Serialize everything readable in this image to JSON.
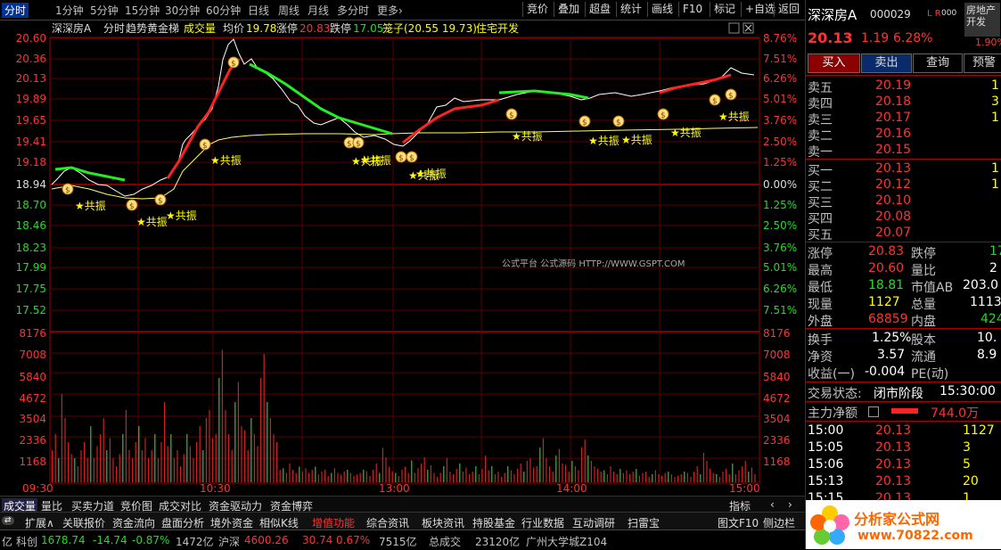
{
  "top_tabs": [
    "分时",
    "1分钟",
    "5分钟",
    "15分钟",
    "30分钟",
    "60分钟",
    "日线",
    "周线",
    "月线",
    "多分时",
    "更多›"
  ],
  "top_buttons": [
    "竞价",
    "叠加",
    "超盘",
    "统计",
    "画线",
    "F10",
    "标记",
    "+自选",
    "返回"
  ],
  "chart": {
    "stock": "深深房A",
    "mode": "分时",
    "indicator_name": "趋势黄金梯",
    "volume_label": "成交量",
    "avg_label": "均价",
    "avg_value": "19.78",
    "limit_up_label": "涨停",
    "limit_up_value": "20.83",
    "limit_down_label": "跌停",
    "limit_down_value": "17.05",
    "cursor_label": "笼子(20.55 19.73)",
    "sector": "住宅开发",
    "watermark": "公式平台 公式源码 HTTP://WWW.GSPT.COM",
    "price_ticks": [
      "20.60",
      "20.36",
      "20.13",
      "19.89",
      "19.65",
      "19.41",
      "19.18",
      "18.94",
      "18.70",
      "18.46",
      "18.23",
      "17.99",
      "17.75",
      "17.52"
    ],
    "pct_ticks": [
      "8.76%",
      "7.51%",
      "6.26%",
      "5.01%",
      "3.76%",
      "2.50%",
      "1.25%",
      "0.00%",
      "1.25%",
      "2.50%",
      "3.76%",
      "5.01%",
      "6.26%",
      "7.51%"
    ],
    "vol_ticks": [
      "8176",
      "7008",
      "5840",
      "4672",
      "3504",
      "2336",
      "1168"
    ],
    "time_ticks": [
      "09:30",
      "10:30",
      "13:00",
      "14:00",
      "15:00"
    ],
    "gongzhen_label": "共振",
    "gongzhen_count": 14,
    "moneybag_count": 15
  },
  "bottom_tabs": [
    "成交量",
    "量比",
    "买卖力道",
    "竞价图",
    "成交对比",
    "资金驱动力",
    "资金博弈"
  ],
  "bottom_right": [
    "指标",
    "‹",
    "›"
  ],
  "toolbar_items": [
    "扩展∧",
    "关联报价",
    "资金流向",
    "盘面分析",
    "境外资金",
    "相似K线",
    "增值功能",
    "综合资讯",
    "板块资讯",
    "持股基金",
    "行业数据",
    "互动调研",
    "扫雷宝"
  ],
  "toolbar_right": [
    "图文F10",
    "侧边栏"
  ],
  "status_bar": {
    "prefix": "亿",
    "idx1_name": "科创",
    "idx1_value": "1678.74",
    "idx1_change": "-14.74",
    "idx1_pct": "-0.87%",
    "idx1_amount": "1472亿",
    "idx2_name": "沪深",
    "idx2_value": "4600.26",
    "idx2_change": "30.74",
    "idx2_pct": "0.67%",
    "idx2_amount": "7515亿",
    "total_label": "总成交",
    "total_value": "23120亿",
    "ticker": "广州大学城Z104"
  },
  "quote": {
    "name": "深深房A",
    "code": "000029",
    "flags": "L R",
    "flag_suffix": "000",
    "sector_badge": "房地产开发",
    "sector_pct": "1.90%",
    "price": "20.13",
    "change": "1.19",
    "pct": "6.28%",
    "buttons": [
      "买入",
      "卖出",
      "查询",
      "预警"
    ],
    "asks": [
      {
        "label": "卖五",
        "price": "20.19",
        "vol": "1"
      },
      {
        "label": "卖四",
        "price": "20.18",
        "vol": "3"
      },
      {
        "label": "卖三",
        "price": "20.17",
        "vol": "1"
      },
      {
        "label": "卖二",
        "price": "20.16",
        "vol": ""
      },
      {
        "label": "卖一",
        "price": "20.15",
        "vol": ""
      }
    ],
    "bids": [
      {
        "label": "买一",
        "price": "20.13",
        "vol": "1"
      },
      {
        "label": "买二",
        "price": "20.12",
        "vol": "1"
      },
      {
        "label": "买三",
        "price": "20.10",
        "vol": ""
      },
      {
        "label": "买四",
        "price": "20.08",
        "vol": ""
      },
      {
        "label": "买五",
        "price": "20.07",
        "vol": ""
      }
    ],
    "stats": [
      {
        "l1": "涨停",
        "v1": "20.83",
        "c1": "red",
        "l2": "跌停",
        "v2": "17",
        "c2": "green"
      },
      {
        "l1": "最高",
        "v1": "20.60",
        "c1": "red",
        "l2": "量比",
        "v2": "2",
        "c2": "white"
      },
      {
        "l1": "最低",
        "v1": "18.81",
        "c1": "green",
        "l2": "市值AB",
        "v2": "203.0",
        "c2": "white"
      },
      {
        "l1": "现量",
        "v1": "1127",
        "c1": "yellow",
        "l2": "总量",
        "v2": "1113",
        "c2": "white"
      },
      {
        "l1": "外盘",
        "v1": "68859",
        "c1": "red",
        "l2": "内盘",
        "v2": "424",
        "c2": "green"
      }
    ],
    "stats2": [
      {
        "l1": "换手",
        "v1": "1.25%",
        "l2": "股本",
        "v2": "10."
      },
      {
        "l1": "净资",
        "v1": "3.57",
        "l2": "流通",
        "v2": "8.9"
      },
      {
        "l1": "收益(一)",
        "v1": "-0.004",
        "l2": "PE(动)",
        "v2": ""
      }
    ],
    "trade_state_label": "交易状态:",
    "trade_state": "闭市阶段",
    "trade_time": "15:30:00",
    "main_flow_label": "主力净额",
    "main_flow_value": "744.0万",
    "trades": [
      {
        "t": "15:00",
        "p": "20.13",
        "v": "1127"
      },
      {
        "t": "15:05",
        "p": "20.13",
        "v": "3"
      },
      {
        "t": "15:06",
        "p": "20.13",
        "v": "5"
      },
      {
        "t": "15:13",
        "p": "20.13",
        "v": "20"
      },
      {
        "t": "15:15",
        "p": "20.13",
        "v": "1"
      }
    ],
    "logo_text": "分析家公式网",
    "logo_url": "www.70822.com"
  }
}
